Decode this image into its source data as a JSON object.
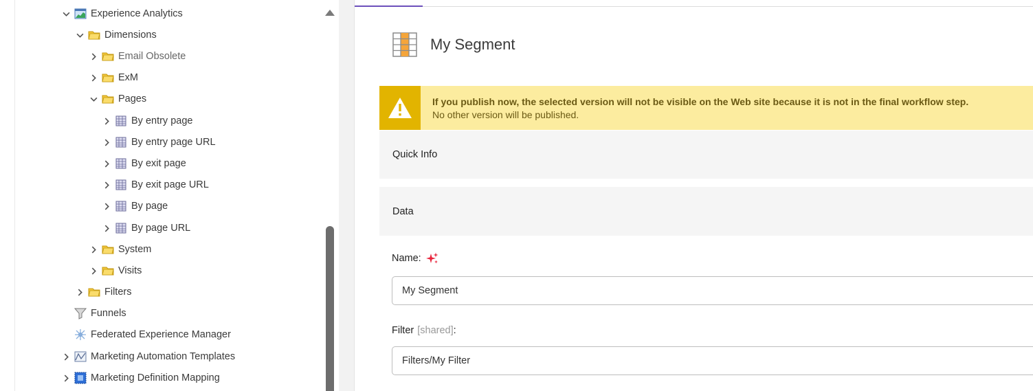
{
  "tree": {
    "items": [
      {
        "label": "Experience Analytics",
        "expanded": true,
        "icon": "analytics-chart-icon"
      },
      {
        "label": "Dimensions",
        "expanded": true,
        "icon": "folder-icon"
      },
      {
        "label": "Email Obsolete",
        "expanded": false,
        "icon": "folder-icon"
      },
      {
        "label": "ExM",
        "expanded": false,
        "icon": "folder-icon"
      },
      {
        "label": "Pages",
        "expanded": true,
        "icon": "folder-icon"
      },
      {
        "label": "By entry page",
        "expanded": false,
        "icon": "segment-grid-icon"
      },
      {
        "label": "By entry page URL",
        "expanded": false,
        "icon": "segment-grid-icon"
      },
      {
        "label": "By exit page",
        "expanded": false,
        "icon": "segment-grid-icon"
      },
      {
        "label": "By exit page URL",
        "expanded": false,
        "icon": "segment-grid-icon"
      },
      {
        "label": "By page",
        "expanded": false,
        "icon": "segment-grid-icon"
      },
      {
        "label": "By page URL",
        "expanded": false,
        "icon": "segment-grid-icon"
      },
      {
        "label": "System",
        "expanded": false,
        "icon": "folder-icon"
      },
      {
        "label": "Visits",
        "expanded": false,
        "icon": "folder-icon"
      },
      {
        "label": "Filters",
        "expanded": false,
        "icon": "folder-icon"
      },
      {
        "label": "Funnels",
        "expanded": null,
        "icon": "funnel-icon"
      },
      {
        "label": "Federated Experience Manager",
        "expanded": null,
        "icon": "federated-icon"
      },
      {
        "label": "Marketing Automation Templates",
        "expanded": false,
        "icon": "automation-map-icon"
      },
      {
        "label": "Marketing Definition Mapping",
        "expanded": false,
        "icon": "mapping-icon"
      }
    ]
  },
  "editor": {
    "title": "My Segment",
    "warning": {
      "strong": "If you publish now, the selected version will not be visible on the Web site because it is not in the final workflow step.",
      "sub": "No other version will be published."
    },
    "sections": {
      "quick_info": "Quick Info",
      "data": "Data"
    },
    "fields": {
      "name_label": "Name:",
      "name_value": "My Segment",
      "filter_label": "Filter",
      "filter_shared": "[shared]",
      "filter_colon": ":",
      "filter_value": "Filters/My Filter"
    }
  },
  "colors": {
    "warning_bg": "#fcec9f",
    "warning_icon_bg": "#e2b400",
    "active_tab": "#6b4fbb",
    "folder": "#f3c63b"
  }
}
